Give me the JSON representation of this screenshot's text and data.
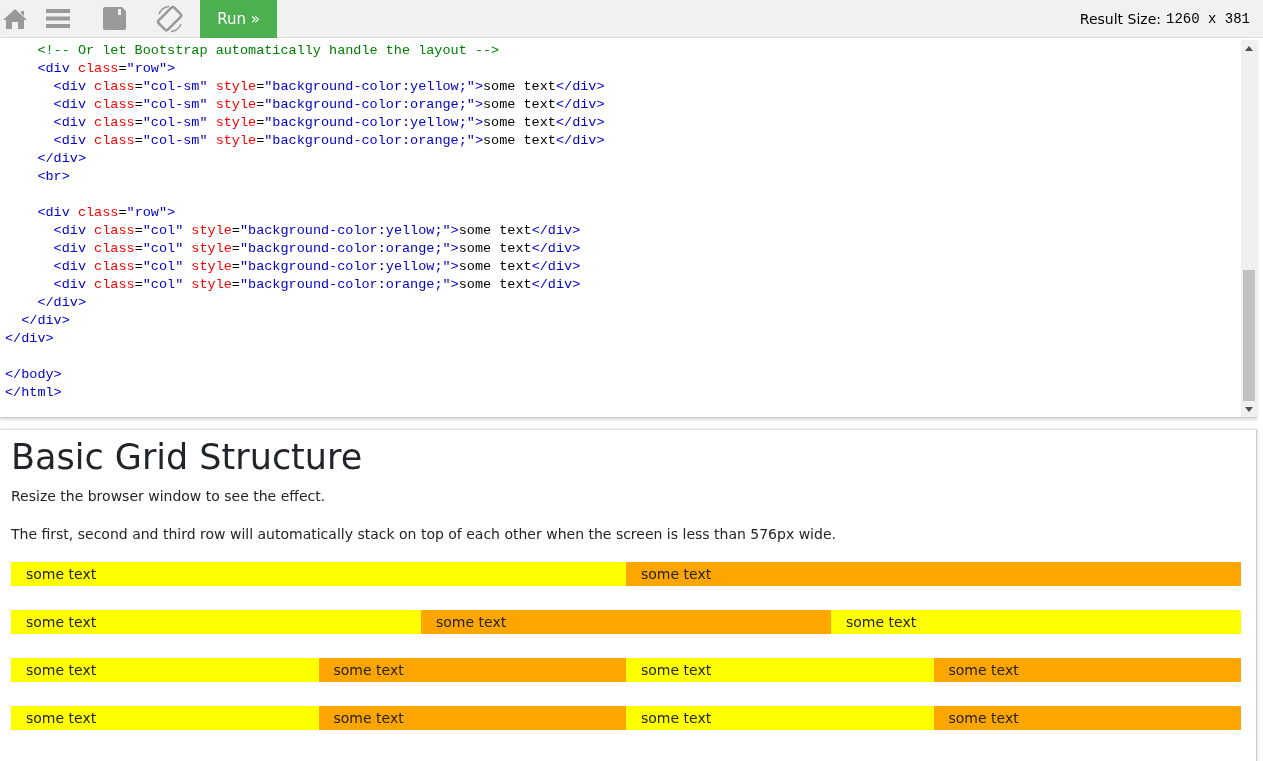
{
  "toolbar": {
    "run_button": "Run »",
    "result_size_label": "Result Size:",
    "result_size_value": "1260 x 381"
  },
  "code_blocks": [
    [
      [
        {
          "kind": "comment",
          "text": "    <!-- Or let Bootstrap automatically handle the layout -->"
        }
      ],
      [
        {
          "kind": "tag",
          "text": "    <div"
        },
        {
          "kind": "attr",
          "text": " class"
        },
        {
          "kind": "text",
          "text": "="
        },
        {
          "kind": "value",
          "text": "\"row\""
        },
        {
          "kind": "tag",
          "text": ">"
        }
      ],
      [
        {
          "kind": "tag",
          "text": "      <div"
        },
        {
          "kind": "attr",
          "text": " class"
        },
        {
          "kind": "text",
          "text": "="
        },
        {
          "kind": "value",
          "text": "\"col-sm\""
        },
        {
          "kind": "attr",
          "text": " style"
        },
        {
          "kind": "text",
          "text": "="
        },
        {
          "kind": "value",
          "text": "\"background-color:yellow;\""
        },
        {
          "kind": "tag",
          "text": ">"
        },
        {
          "kind": "text",
          "text": "some text"
        },
        {
          "kind": "tag",
          "text": "</div>"
        }
      ],
      [
        {
          "kind": "tag",
          "text": "      <div"
        },
        {
          "kind": "attr",
          "text": " class"
        },
        {
          "kind": "text",
          "text": "="
        },
        {
          "kind": "value",
          "text": "\"col-sm\""
        },
        {
          "kind": "attr",
          "text": " style"
        },
        {
          "kind": "text",
          "text": "="
        },
        {
          "kind": "value",
          "text": "\"background-color:orange;\""
        },
        {
          "kind": "tag",
          "text": ">"
        },
        {
          "kind": "text",
          "text": "some text"
        },
        {
          "kind": "tag",
          "text": "</div>"
        }
      ],
      [
        {
          "kind": "tag",
          "text": "      <div"
        },
        {
          "kind": "attr",
          "text": " class"
        },
        {
          "kind": "text",
          "text": "="
        },
        {
          "kind": "value",
          "text": "\"col-sm\""
        },
        {
          "kind": "attr",
          "text": " style"
        },
        {
          "kind": "text",
          "text": "="
        },
        {
          "kind": "value",
          "text": "\"background-color:yellow;\""
        },
        {
          "kind": "tag",
          "text": ">"
        },
        {
          "kind": "text",
          "text": "some text"
        },
        {
          "kind": "tag",
          "text": "</div>"
        }
      ],
      [
        {
          "kind": "tag",
          "text": "      <div"
        },
        {
          "kind": "attr",
          "text": " class"
        },
        {
          "kind": "text",
          "text": "="
        },
        {
          "kind": "value",
          "text": "\"col-sm\""
        },
        {
          "kind": "attr",
          "text": " style"
        },
        {
          "kind": "text",
          "text": "="
        },
        {
          "kind": "value",
          "text": "\"background-color:orange;\""
        },
        {
          "kind": "tag",
          "text": ">"
        },
        {
          "kind": "text",
          "text": "some text"
        },
        {
          "kind": "tag",
          "text": "</div>"
        }
      ],
      [
        {
          "kind": "tag",
          "text": "    </div>"
        }
      ],
      [
        {
          "kind": "tag",
          "text": "    <br>"
        }
      ]
    ],
    [
      [
        {
          "kind": "tag",
          "text": "    <div"
        },
        {
          "kind": "attr",
          "text": " class"
        },
        {
          "kind": "text",
          "text": "="
        },
        {
          "kind": "value",
          "text": "\"row\""
        },
        {
          "kind": "tag",
          "text": ">"
        }
      ],
      [
        {
          "kind": "tag",
          "text": "      <div"
        },
        {
          "kind": "attr",
          "text": " class"
        },
        {
          "kind": "text",
          "text": "="
        },
        {
          "kind": "value",
          "text": "\"col\""
        },
        {
          "kind": "attr",
          "text": " style"
        },
        {
          "kind": "text",
          "text": "="
        },
        {
          "kind": "value",
          "text": "\"background-color:yellow;\""
        },
        {
          "kind": "tag",
          "text": ">"
        },
        {
          "kind": "text",
          "text": "some text"
        },
        {
          "kind": "tag",
          "text": "</div>"
        }
      ],
      [
        {
          "kind": "tag",
          "text": "      <div"
        },
        {
          "kind": "attr",
          "text": " class"
        },
        {
          "kind": "text",
          "text": "="
        },
        {
          "kind": "value",
          "text": "\"col\""
        },
        {
          "kind": "attr",
          "text": " style"
        },
        {
          "kind": "text",
          "text": "="
        },
        {
          "kind": "value",
          "text": "\"background-color:orange;\""
        },
        {
          "kind": "tag",
          "text": ">"
        },
        {
          "kind": "text",
          "text": "some text"
        },
        {
          "kind": "tag",
          "text": "</div>"
        }
      ],
      [
        {
          "kind": "tag",
          "text": "      <div"
        },
        {
          "kind": "attr",
          "text": " class"
        },
        {
          "kind": "text",
          "text": "="
        },
        {
          "kind": "value",
          "text": "\"col\""
        },
        {
          "kind": "attr",
          "text": " style"
        },
        {
          "kind": "text",
          "text": "="
        },
        {
          "kind": "value",
          "text": "\"background-color:yellow;\""
        },
        {
          "kind": "tag",
          "text": ">"
        },
        {
          "kind": "text",
          "text": "some text"
        },
        {
          "kind": "tag",
          "text": "</div>"
        }
      ],
      [
        {
          "kind": "tag",
          "text": "      <div"
        },
        {
          "kind": "attr",
          "text": " class"
        },
        {
          "kind": "text",
          "text": "="
        },
        {
          "kind": "value",
          "text": "\"col\""
        },
        {
          "kind": "attr",
          "text": " style"
        },
        {
          "kind": "text",
          "text": "="
        },
        {
          "kind": "value",
          "text": "\"background-color:orange;\""
        },
        {
          "kind": "tag",
          "text": ">"
        },
        {
          "kind": "text",
          "text": "some text"
        },
        {
          "kind": "tag",
          "text": "</div>"
        }
      ],
      [
        {
          "kind": "tag",
          "text": "    </div>"
        }
      ],
      [
        {
          "kind": "tag",
          "text": "  </div>"
        }
      ],
      [
        {
          "kind": "tag",
          "text": "</div>"
        }
      ]
    ],
    [
      [
        {
          "kind": "tag",
          "text": "</body>"
        }
      ],
      [
        {
          "kind": "tag",
          "text": "</html>"
        }
      ]
    ]
  ],
  "result": {
    "heading": "Basic Grid Structure",
    "paragraphs": [
      "Resize the browser window to see the effect.",
      "The first, second and third row will automatically stack on top of each other when the screen is less than 576px wide."
    ],
    "grid_rows": [
      {
        "columns": [
          {
            "text": "some text",
            "color": "#ffff00"
          },
          {
            "text": "some text",
            "color": "#ffa500"
          }
        ]
      },
      {
        "columns": [
          {
            "text": "some text",
            "color": "#ffff00"
          },
          {
            "text": "some text",
            "color": "#ffa500"
          },
          {
            "text": "some text",
            "color": "#ffff00"
          }
        ]
      },
      {
        "columns": [
          {
            "text": "some text",
            "color": "#ffff00"
          },
          {
            "text": "some text",
            "color": "#ffa500"
          },
          {
            "text": "some text",
            "color": "#ffff00"
          },
          {
            "text": "some text",
            "color": "#ffa500"
          }
        ]
      },
      {
        "columns": [
          {
            "text": "some text",
            "color": "#ffff00"
          },
          {
            "text": "some text",
            "color": "#ffa500"
          },
          {
            "text": "some text",
            "color": "#ffff00"
          },
          {
            "text": "some text",
            "color": "#ffa500"
          }
        ]
      }
    ]
  }
}
